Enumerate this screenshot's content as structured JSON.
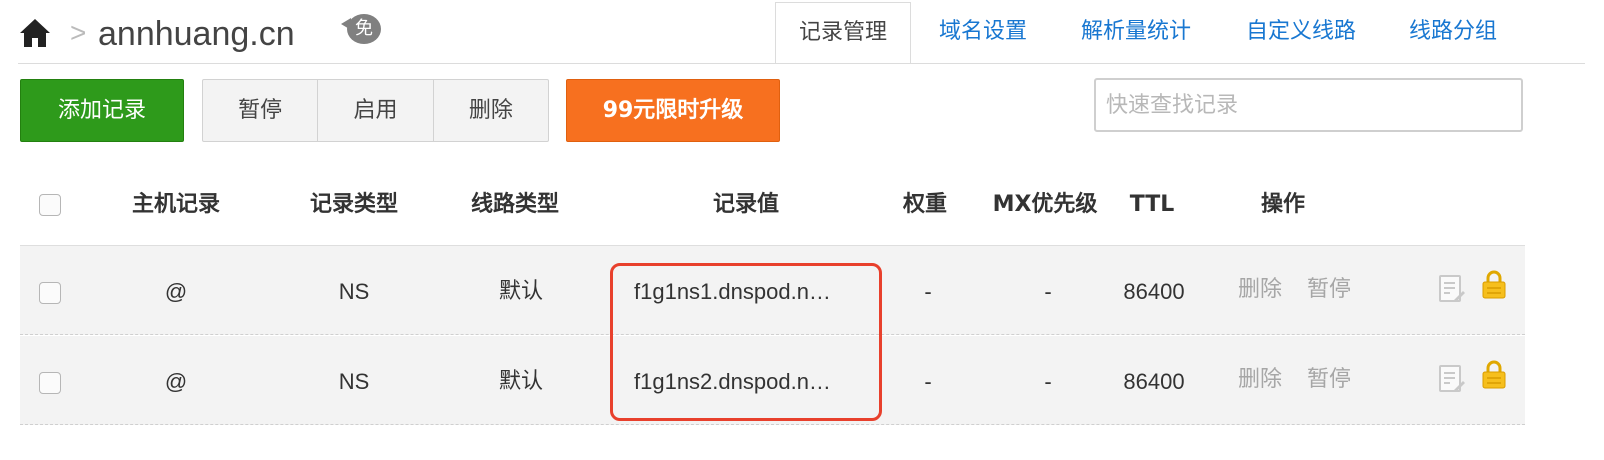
{
  "breadcrumb": {
    "home_icon": "home-icon",
    "separator": ">",
    "domain": "annhuang.cn",
    "badge": "免"
  },
  "tabs": [
    {
      "label": "记录管理",
      "active": true
    },
    {
      "label": "域名设置",
      "active": false
    },
    {
      "label": "解析量统计",
      "active": false
    },
    {
      "label": "自定义线路",
      "active": false
    },
    {
      "label": "线路分组",
      "active": false
    }
  ],
  "toolbar": {
    "add_label": "添加记录",
    "pause_label": "暂停",
    "enable_label": "启用",
    "delete_label": "删除",
    "upgrade_label": "99元限时升级"
  },
  "search": {
    "placeholder": "快速查找记录",
    "value": ""
  },
  "table": {
    "columns": [
      "主机记录",
      "记录类型",
      "线路类型",
      "记录值",
      "权重",
      "MX优先级",
      "TTL",
      "操作"
    ],
    "rows": [
      {
        "host": "@",
        "type": "NS",
        "line": "默认",
        "value": "f1g1ns1.dnspod.n…",
        "weight": "-",
        "mx": "-",
        "ttl": "86400",
        "action_delete": "删除",
        "action_pause": "暂停"
      },
      {
        "host": "@",
        "type": "NS",
        "line": "默认",
        "value": "f1g1ns2.dnspod.n…",
        "weight": "-",
        "mx": "-",
        "ttl": "86400",
        "action_delete": "删除",
        "action_pause": "暂停"
      }
    ]
  },
  "colors": {
    "accent_link": "#1877d1",
    "add_button": "#2e9a1b",
    "upgrade_button": "#f7701f",
    "highlight": "#e8402c"
  }
}
